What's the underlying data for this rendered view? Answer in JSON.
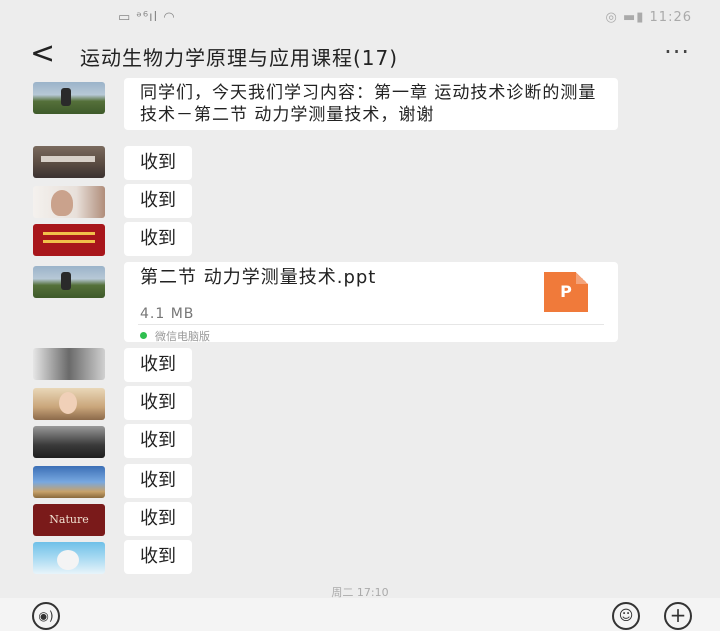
{
  "status_bar": {
    "left": "▭ ᵊ⁶ıl ◠",
    "right": "◎ ▬▮ 11:26"
  },
  "header": {
    "back": "<",
    "title": "运动生物力学原理与应用课程(17)",
    "more": "···"
  },
  "messages": [
    {
      "type": "text",
      "text": "同学们，今天我们学习内容：第一章 运动技术诊断的测量技术－第二节 动力学测量技术，谢谢"
    },
    {
      "type": "text",
      "text": "收到"
    },
    {
      "type": "text",
      "text": "收到"
    },
    {
      "type": "text",
      "text": "收到"
    },
    {
      "type": "file",
      "name": "第二节 动力学测量技术.ppt",
      "size": "4.1 MB",
      "icon_letter": "P",
      "source": "微信电脑版"
    },
    {
      "type": "text",
      "text": "收到"
    },
    {
      "type": "text",
      "text": "收到"
    },
    {
      "type": "text",
      "text": "收到"
    },
    {
      "type": "text",
      "text": "收到"
    },
    {
      "type": "text",
      "text": "收到"
    },
    {
      "type": "text",
      "text": "收到"
    }
  ],
  "avatars": {
    "red_card_text": "Nature"
  },
  "time_separator": "周二 17:10",
  "input_bar": {
    "voice_icon": "voice-icon",
    "emoji_icon": "emoji-icon",
    "plus_icon": "plus-icon"
  },
  "colors": {
    "background": "#ededed",
    "bubble": "#ffffff",
    "file_icon": "#f07a3a",
    "source_dot": "#2fbf4f"
  }
}
